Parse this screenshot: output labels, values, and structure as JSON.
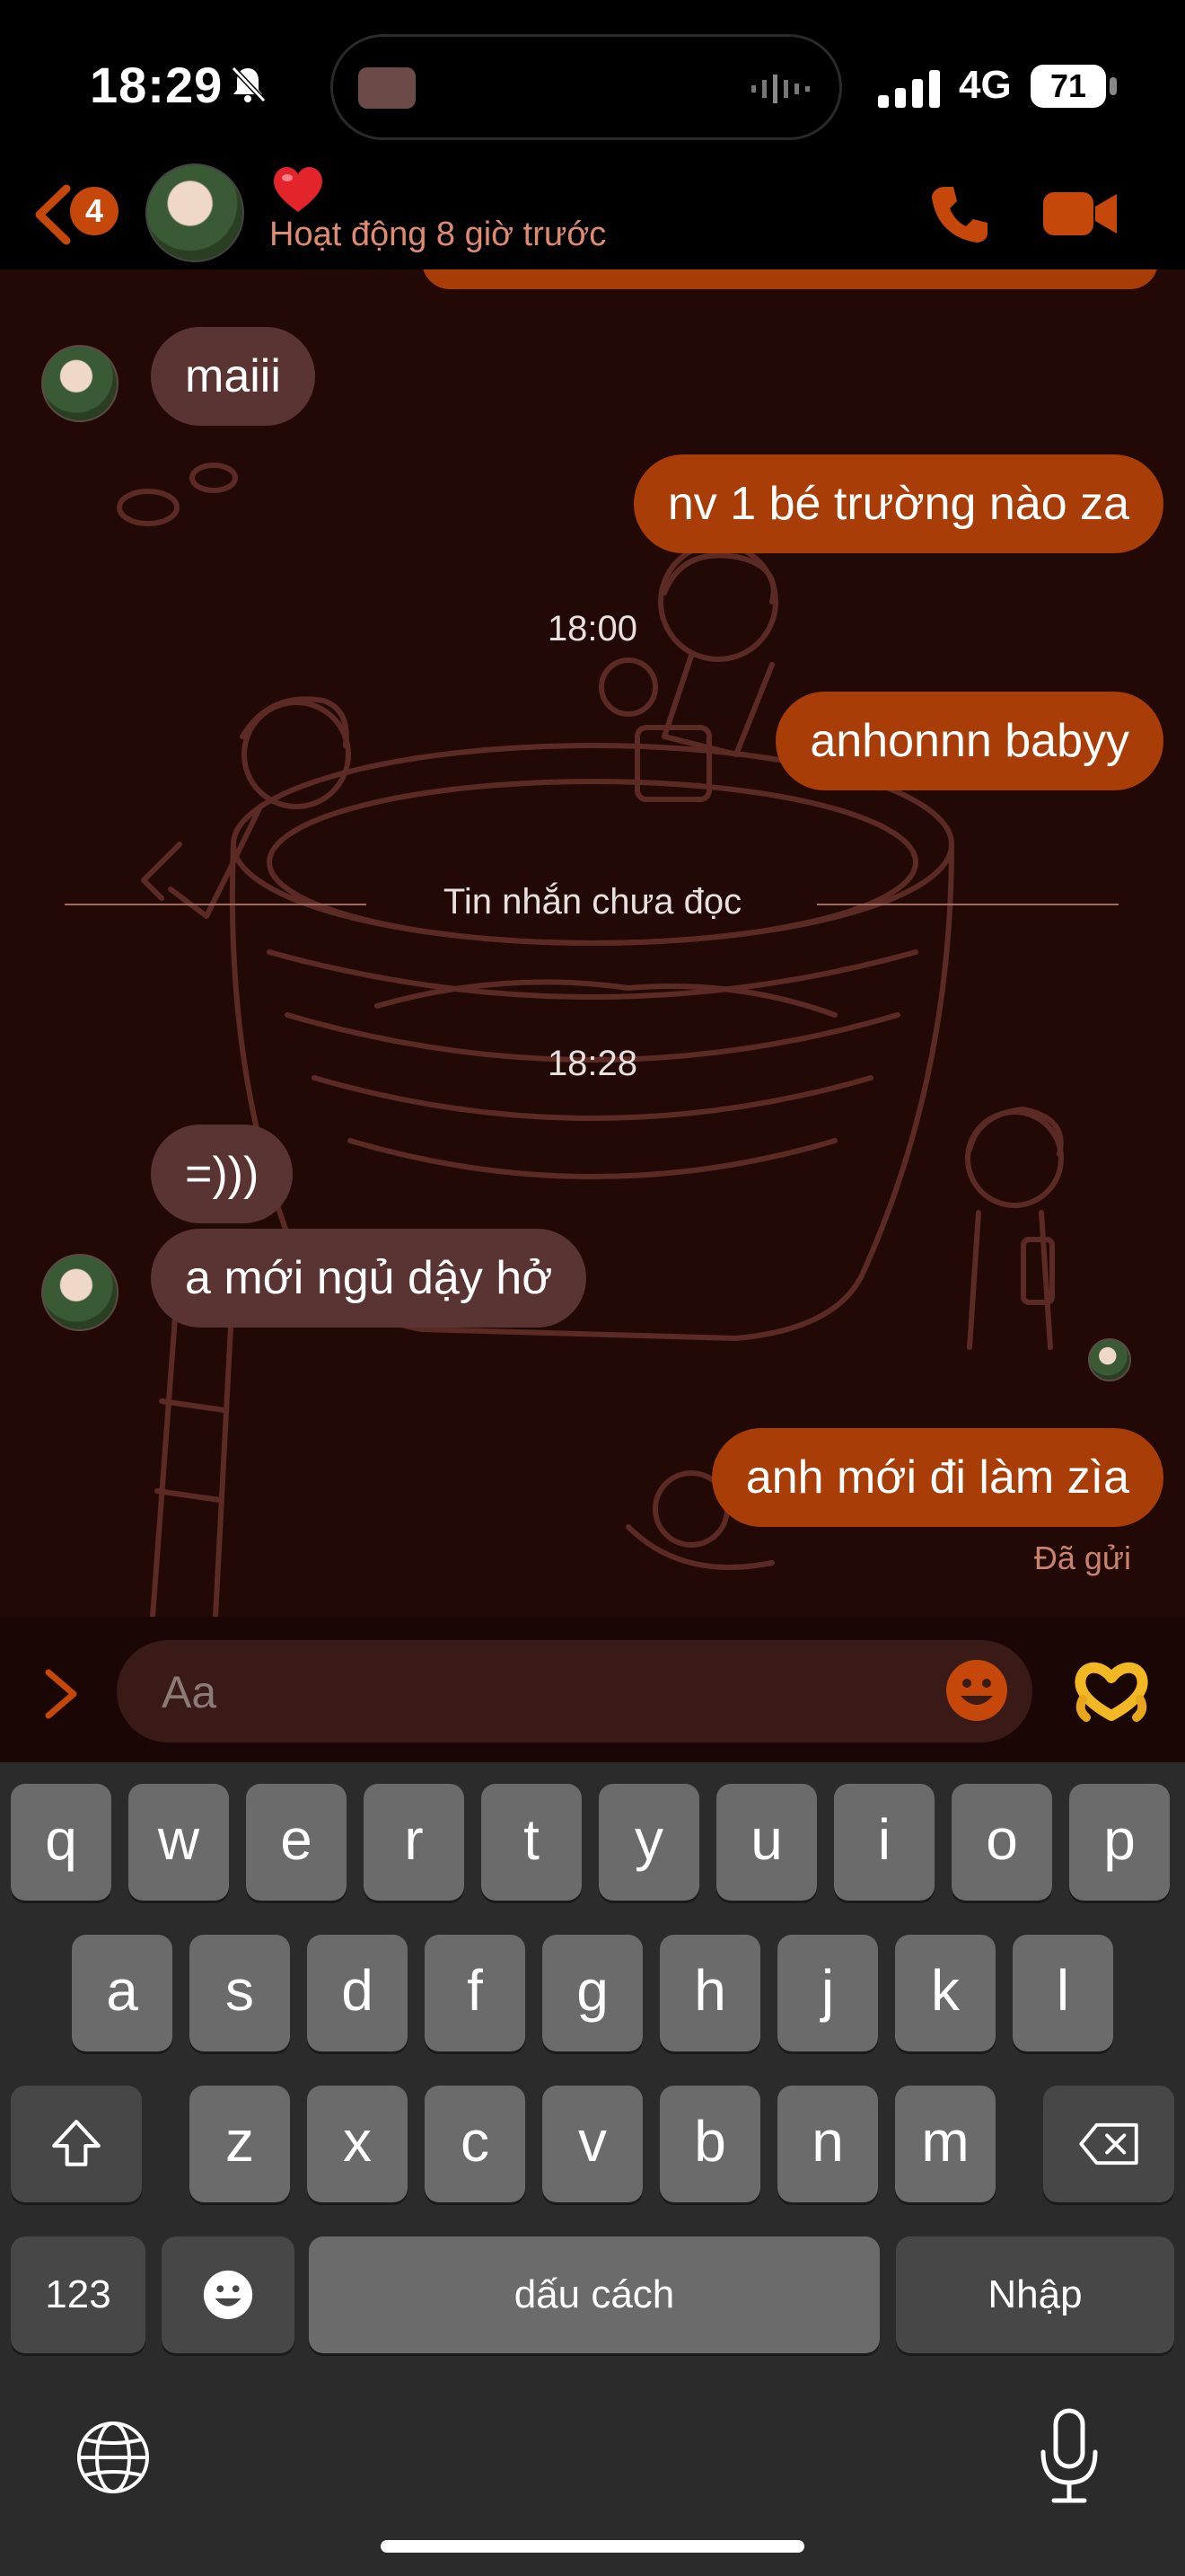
{
  "status_bar": {
    "time": "18:29",
    "network": "4G",
    "battery": "71"
  },
  "header": {
    "back_badge": "4",
    "status": "Hoạt động 8 giờ trước"
  },
  "messages": [
    {
      "dir": "in",
      "text": "maiii"
    },
    {
      "dir": "out",
      "text": "nv 1 bé trường nào za"
    },
    {
      "dir": "time",
      "text": "18:00"
    },
    {
      "dir": "out",
      "text": "anhonnn babyy"
    },
    {
      "dir": "divider",
      "text": "Tin nhắn chưa đọc"
    },
    {
      "dir": "time",
      "text": "18:28"
    },
    {
      "dir": "in",
      "text": "=)))"
    },
    {
      "dir": "in",
      "text": "a mới ngủ dậy hở"
    },
    {
      "dir": "out",
      "text": "anh mới đi làm zìa"
    }
  ],
  "sent_status": "Đã gửi",
  "composer": {
    "placeholder": "Aa"
  },
  "keyboard": {
    "row1": [
      "q",
      "w",
      "e",
      "r",
      "t",
      "y",
      "u",
      "i",
      "o",
      "p"
    ],
    "row2": [
      "a",
      "s",
      "d",
      "f",
      "g",
      "h",
      "j",
      "k",
      "l"
    ],
    "row3": [
      "z",
      "x",
      "c",
      "v",
      "b",
      "n",
      "m"
    ],
    "numbers_key": "123",
    "space_key": "dấu cách",
    "return_key": "Nhập"
  },
  "colors": {
    "accent": "#c6470a",
    "outgoing_bubble": "#a83d08",
    "incoming_bubble": "#5a3432",
    "chat_bg": "#230906"
  },
  "icons": [
    "bell-slash-icon",
    "signal-icon",
    "back-icon",
    "heart-icon",
    "phone-icon",
    "video-icon",
    "chevron-right-icon",
    "emoji-icon",
    "heart-hands-icon",
    "shift-icon",
    "delete-icon",
    "emoji-key-icon",
    "globe-icon",
    "mic-icon"
  ]
}
